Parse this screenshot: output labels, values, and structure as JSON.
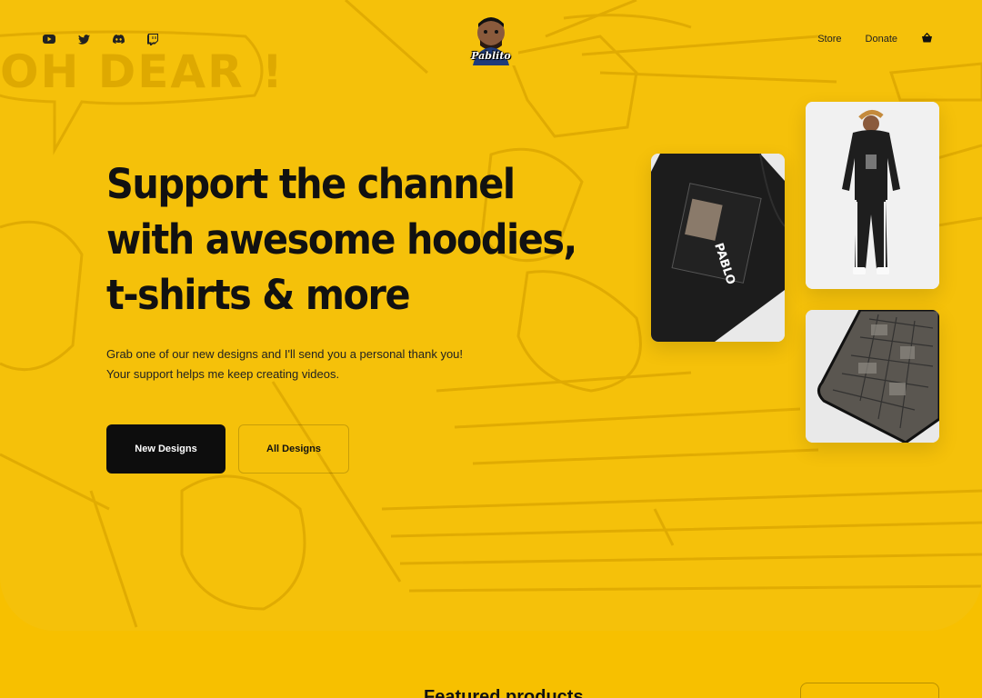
{
  "header": {
    "social": [
      "youtube-icon",
      "twitter-icon",
      "discord-icon",
      "twitch-icon"
    ],
    "logo_text": "Pablito",
    "nav": {
      "store": "Store",
      "donate": "Donate",
      "cart_icon": "basket-icon"
    }
  },
  "hero": {
    "backdrop_text": "OH DEAR !",
    "headline": [
      "Support the channel",
      "with awesome hoodies,",
      "t-shirts & more"
    ],
    "subtext": [
      "Grab one of our new designs and I'll send you a personal thank you!",
      "Your support helps me keep creating videos."
    ],
    "primary_button": "New Designs",
    "secondary_button": "All Designs"
  },
  "products": [
    "Black sweatshirt back print",
    "Model in black hoodie and joggers",
    "Comic print desk mat"
  ],
  "featured": {
    "title": "Featured products"
  },
  "colors": {
    "accent": "#f5c10a",
    "dark": "#0d0d0d"
  }
}
